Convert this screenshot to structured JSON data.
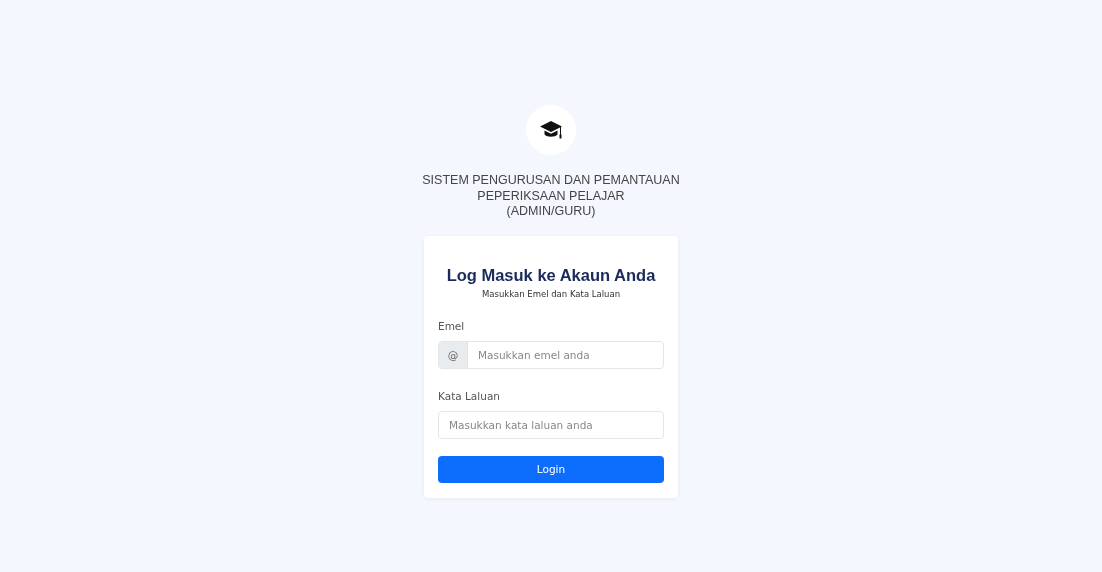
{
  "header": {
    "title_lines": [
      "SISTEM PENGURUSAN DAN PEMANTAUAN",
      "PEPERIKSAAN PELAJAR",
      "(ADMIN/GURU)"
    ]
  },
  "card": {
    "title": "Log Masuk ke Akaun Anda",
    "subtitle": "Masukkan Emel dan Kata Laluan",
    "fields": [
      {
        "kind": "prefixed",
        "label": "Emel",
        "prefix": "@",
        "placeholder": "Masukkan emel anda"
      },
      {
        "kind": "plain",
        "label": "Kata Laluan",
        "placeholder": "Masukkan kata laluan anda"
      }
    ],
    "button": "Login"
  }
}
